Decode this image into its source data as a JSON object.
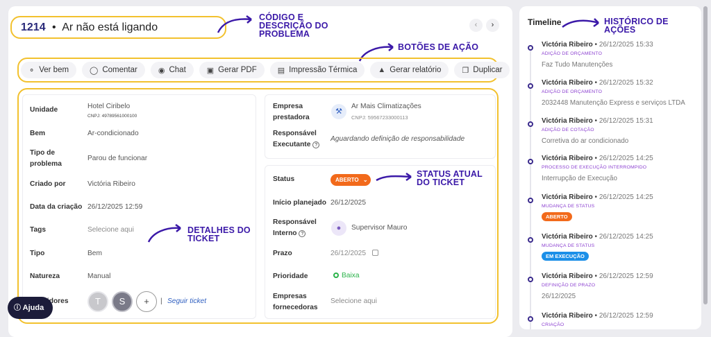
{
  "header": {
    "ticket_code": "1214",
    "separator": "•",
    "ticket_description": "Ar não está ligando",
    "prev_icon": "chevron-left-icon",
    "next_icon": "chevron-right-icon"
  },
  "annotations": {
    "code_description": [
      "CÓDIGO E",
      "DESCRIÇÃO DO",
      "PROBLEMA"
    ],
    "action_buttons": "BOTÕES DE AÇÃO",
    "ticket_details": [
      "DETALHES DO",
      "TICKET"
    ],
    "current_status": [
      "STATUS ATUAL",
      "DO TICKET"
    ],
    "action_history": [
      "HISTÓRICO DE",
      "AÇÕES"
    ],
    "accent_color": "#3b19a8",
    "highlight_color": "#f2c12e"
  },
  "toolbar": [
    {
      "label": "Ver bem",
      "icon": "tag-icon"
    },
    {
      "label": "Comentar",
      "icon": "comment-icon"
    },
    {
      "label": "Chat",
      "icon": "chat-icon"
    },
    {
      "label": "Gerar PDF",
      "icon": "pdf-icon"
    },
    {
      "label": "Impressão Térmica",
      "icon": "printer-icon"
    },
    {
      "label": "Gerar relatório",
      "icon": "chart-icon"
    },
    {
      "label": "Duplicar",
      "icon": "copy-icon"
    }
  ],
  "details": {
    "unidade_label": "Unidade",
    "unidade_value": "Hotel Ciribelo",
    "unidade_cnpj": "CNPJ: 49789561000100",
    "bem_label": "Bem",
    "bem_value": "Ar-condicionado",
    "tipo_problema_label": [
      "Tipo de",
      "problema"
    ],
    "tipo_problema_value": "Parou de funcionar",
    "criado_por_label": "Criado por",
    "criado_por_value": "Victória Ribeiro",
    "data_criacao_label": "Data da criação",
    "data_criacao_value": "26/12/2025 12:59",
    "tags_label": "Tags",
    "tags_placeholder": "Selecione aqui",
    "tipo_label": "Tipo",
    "tipo_value": "Bem",
    "natureza_label": "Natureza",
    "natureza_value": "Manual",
    "seguidores_label": "Seguidores",
    "follower_1": "T",
    "follower_2": "S",
    "add_follower": "+",
    "follow_separator": "|",
    "follow_link": "Seguir ticket"
  },
  "provider": {
    "empresa_label": [
      "Empresa",
      "prestadora"
    ],
    "empresa_value": "Ar Mais Climatizações",
    "empresa_cnpj": "CNPJ: 59567233000113",
    "empresa_icon": "wrench-icon",
    "responsavel_label": [
      "Responsável",
      "Executante"
    ],
    "responsavel_value": "Aguardando definição de responsabilidade"
  },
  "status_card": {
    "status_label": "Status",
    "status_value": "ABERTO",
    "status_color": "#f26a1b",
    "inicio_label": "Início planejado",
    "inicio_value": "26/12/2025",
    "resp_interno_label": [
      "Responsável",
      "Interno"
    ],
    "resp_interno_value": "Supervisor Mauro",
    "prazo_label": "Prazo",
    "prazo_value": "26/12/2025",
    "prioridade_label": "Prioridade",
    "prioridade_value": "Baixa",
    "prioridade_color": "#2bb34a",
    "empresas_label": [
      "Empresas",
      "fornecedoras"
    ],
    "empresas_placeholder": "Selecione aqui"
  },
  "timeline": {
    "title": "Timeline",
    "items": [
      {
        "user": "Victória Ribeiro",
        "date": "26/12/2025 15:33",
        "action": "ADIÇÃO DE ORÇAMENTO",
        "desc": "Faz Tudo Manutenções"
      },
      {
        "user": "Victória Ribeiro",
        "date": "26/12/2025 15:32",
        "action": "ADIÇÃO DE ORÇAMENTO",
        "desc": "2032448 Manutenção Express e serviços LTDA"
      },
      {
        "user": "Victória Ribeiro",
        "date": "26/12/2025 15:31",
        "action": "ADIÇÃO DE COTAÇÃO",
        "desc": "Corretiva do ar condicionado"
      },
      {
        "user": "Victória Ribeiro",
        "date": "26/12/2025 14:25",
        "action": "PROCESSO DE EXECUÇÃO INTERROMPIDO",
        "desc": "Interrupção de Execução"
      },
      {
        "user": "Victória Ribeiro",
        "date": "26/12/2025 14:25",
        "action": "MUDANÇA DE STATUS",
        "badge": "ABERTO",
        "badge_color": "#f26a1b"
      },
      {
        "user": "Victória Ribeiro",
        "date": "26/12/2025 14:25",
        "action": "MUDANÇA DE STATUS",
        "badge": "EM EXECUÇÃO",
        "badge_color": "#1b8fe8"
      },
      {
        "user": "Victória Ribeiro",
        "date": "26/12/2025 12:59",
        "action": "DEFINIÇÃO DE PRAZO",
        "desc": "26/12/2025"
      },
      {
        "user": "Victória Ribeiro",
        "date": "26/12/2025 12:59",
        "action": "CRIAÇÃO",
        "desc": ""
      }
    ]
  },
  "help": {
    "label": "Ajuda",
    "icon": "help-icon"
  }
}
